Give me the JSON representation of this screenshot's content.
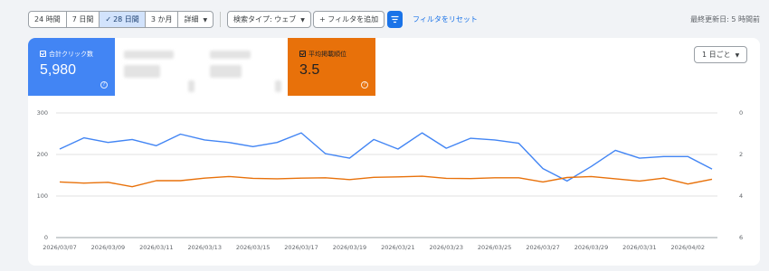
{
  "toolbar": {
    "range_tabs": [
      {
        "label": "24 時間",
        "active": false
      },
      {
        "label": "7 日間",
        "active": false
      },
      {
        "label": "28 日間",
        "active": true
      },
      {
        "label": "3 か月",
        "active": false
      },
      {
        "label": "詳細",
        "active": false
      }
    ],
    "check_glyph": "✓",
    "search_type": "検索タイプ: ウェブ",
    "add_filter": "+ フィルタを追加",
    "reset_filters": "フィルタをリセット",
    "last_updated": "最終更新日: 5 時間前"
  },
  "metrics": {
    "clicks": {
      "label": "合計クリック数",
      "value": "5,980",
      "color": "#4285f4"
    },
    "position": {
      "label": "平均掲載順位",
      "value": "3.5",
      "color": "#e8710a"
    },
    "help_glyph": "?"
  },
  "granularity": "1 日ごと",
  "chart_data": {
    "type": "line",
    "x": [
      "2026/03/07",
      "2026/03/08",
      "2026/03/09",
      "2026/03/10",
      "2026/03/11",
      "2026/03/12",
      "2026/03/13",
      "2026/03/14",
      "2026/03/15",
      "2026/03/16",
      "2026/03/17",
      "2026/03/18",
      "2026/03/19",
      "2026/03/20",
      "2026/03/21",
      "2026/03/22",
      "2026/03/23",
      "2026/03/24",
      "2026/03/25",
      "2026/03/26",
      "2026/03/27",
      "2026/03/28",
      "2026/03/29",
      "2026/03/30",
      "2026/03/31",
      "2026/04/01",
      "2026/04/02",
      "2026/04/03"
    ],
    "x_tick_labels": [
      "2026/03/07",
      "2026/03/09",
      "2026/03/11",
      "2026/03/13",
      "2026/03/15",
      "2026/03/17",
      "2026/03/19",
      "2026/03/21",
      "2026/03/23",
      "2026/03/25",
      "2026/03/27",
      "2026/03/29",
      "2026/03/31",
      "2026/04/02"
    ],
    "series": [
      {
        "key": "clicks",
        "axis": "left",
        "color": "#4285f4",
        "values": [
          213,
          240,
          229,
          236,
          221,
          249,
          235,
          229,
          219,
          229,
          252,
          202,
          191,
          236,
          213,
          252,
          215,
          239,
          235,
          227,
          166,
          136,
          171,
          210,
          191,
          195,
          195,
          165
        ]
      },
      {
        "key": "position",
        "axis": "right",
        "color": "#e8710a",
        "values": [
          3.32,
          3.38,
          3.34,
          3.55,
          3.26,
          3.26,
          3.14,
          3.06,
          3.15,
          3.17,
          3.14,
          3.12,
          3.21,
          3.1,
          3.08,
          3.05,
          3.15,
          3.16,
          3.12,
          3.12,
          3.32,
          3.11,
          3.06,
          3.17,
          3.28,
          3.14,
          3.42,
          3.19
        ]
      }
    ],
    "y_left": {
      "ticks": [
        0,
        100,
        200,
        300
      ],
      "range": [
        0,
        300
      ]
    },
    "y_right": {
      "ticks": [
        0,
        2,
        4,
        6
      ],
      "range": [
        0,
        6
      ],
      "reversed": true
    },
    "grid": true
  }
}
